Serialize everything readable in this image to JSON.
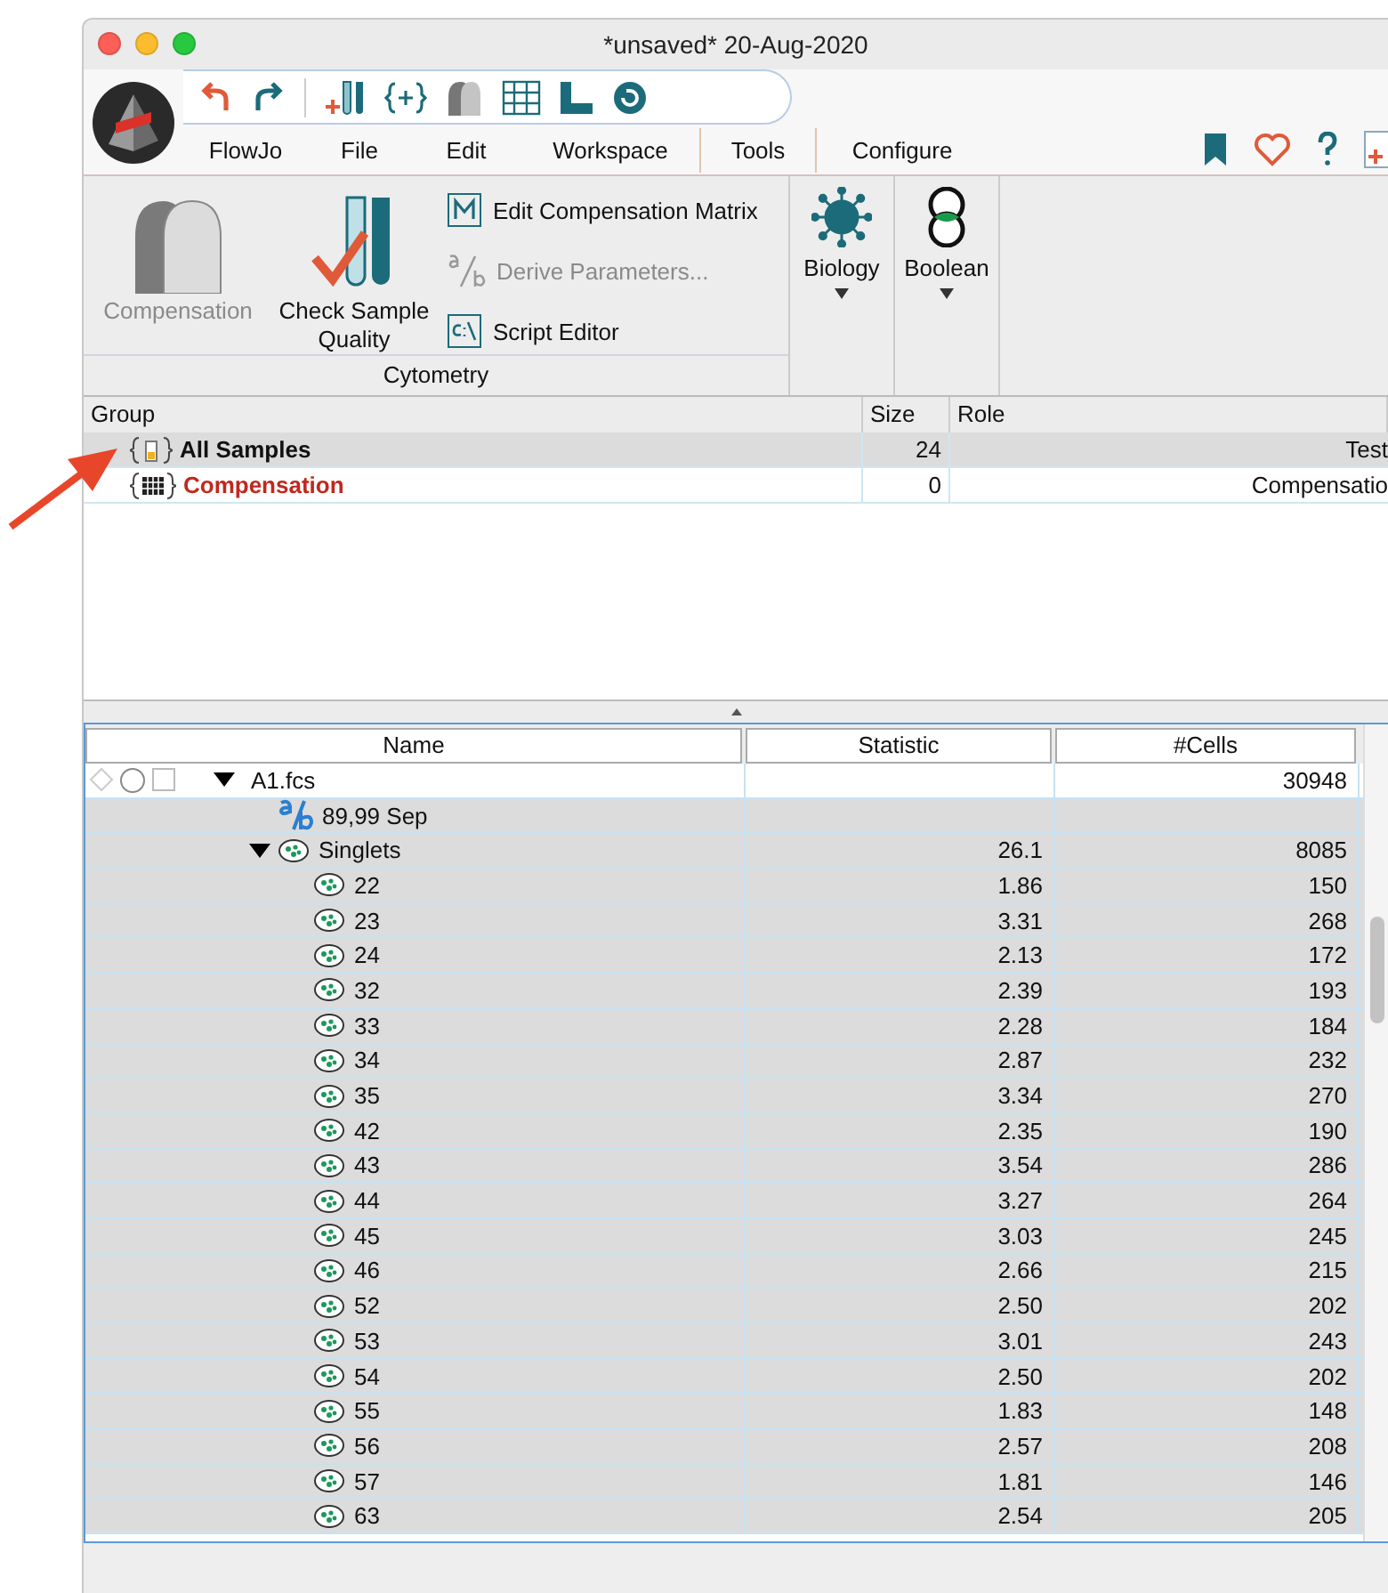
{
  "window": {
    "title": "*unsaved* 20-Aug-2020"
  },
  "menu": [
    {
      "label": "FlowJo",
      "selected": false
    },
    {
      "label": "File",
      "selected": false
    },
    {
      "label": "Edit",
      "selected": false
    },
    {
      "label": "Workspace",
      "selected": false
    },
    {
      "label": "Tools",
      "selected": true
    },
    {
      "label": "Configure",
      "selected": false
    }
  ],
  "ribbon": {
    "group_label": "Cytometry",
    "buttons": [
      {
        "kind": "large",
        "label": "Compensation",
        "disabled": true
      },
      {
        "kind": "large",
        "label": "Check Sample Quality",
        "disabled": false
      },
      {
        "kind": "small",
        "label": "Edit Compensation Matrix",
        "disabled": false
      },
      {
        "kind": "small",
        "label": "Derive Parameters...",
        "disabled": true
      },
      {
        "kind": "small",
        "label": "Script Editor",
        "disabled": false
      }
    ],
    "dropdowns": [
      {
        "label": "Biology"
      },
      {
        "label": "Boolean"
      }
    ]
  },
  "groups_table": {
    "columns": [
      "Group",
      "Size",
      "Role"
    ],
    "rows": [
      {
        "kind": "samples",
        "name": "All Samples",
        "size": "24",
        "role": "Test",
        "selected": true
      },
      {
        "kind": "compensation",
        "name": "Compensation",
        "size": "0",
        "role": "Compensatio",
        "selected": false
      }
    ]
  },
  "samples_table": {
    "columns": [
      "Name",
      "Statistic",
      "#Cells"
    ],
    "rows": [
      {
        "kind": "sample",
        "name": "A1.fcs",
        "cells": "30948",
        "expanded": true,
        "selected": false,
        "children": [
          {
            "kind": "derived",
            "name": "89,99 Sep",
            "selected": true
          },
          {
            "kind": "gate",
            "name": "Singlets",
            "statistic": "26.1",
            "cells": "8085",
            "expanded": true,
            "selected": true,
            "children": [
              {
                "kind": "gate",
                "name": "22",
                "statistic": "1.86",
                "cells": "150",
                "selected": true
              },
              {
                "kind": "gate",
                "name": "23",
                "statistic": "3.31",
                "cells": "268",
                "selected": true
              },
              {
                "kind": "gate",
                "name": "24",
                "statistic": "2.13",
                "cells": "172",
                "selected": true
              },
              {
                "kind": "gate",
                "name": "32",
                "statistic": "2.39",
                "cells": "193",
                "selected": true
              },
              {
                "kind": "gate",
                "name": "33",
                "statistic": "2.28",
                "cells": "184",
                "selected": true
              },
              {
                "kind": "gate",
                "name": "34",
                "statistic": "2.87",
                "cells": "232",
                "selected": true
              },
              {
                "kind": "gate",
                "name": "35",
                "statistic": "3.34",
                "cells": "270",
                "selected": true
              },
              {
                "kind": "gate",
                "name": "42",
                "statistic": "2.35",
                "cells": "190",
                "selected": true
              },
              {
                "kind": "gate",
                "name": "43",
                "statistic": "3.54",
                "cells": "286",
                "selected": true
              },
              {
                "kind": "gate",
                "name": "44",
                "statistic": "3.27",
                "cells": "264",
                "selected": true
              },
              {
                "kind": "gate",
                "name": "45",
                "statistic": "3.03",
                "cells": "245",
                "selected": true
              },
              {
                "kind": "gate",
                "name": "46",
                "statistic": "2.66",
                "cells": "215",
                "selected": true
              },
              {
                "kind": "gate",
                "name": "52",
                "statistic": "2.50",
                "cells": "202",
                "selected": true
              },
              {
                "kind": "gate",
                "name": "53",
                "statistic": "3.01",
                "cells": "243",
                "selected": true
              },
              {
                "kind": "gate",
                "name": "54",
                "statistic": "2.50",
                "cells": "202",
                "selected": true
              },
              {
                "kind": "gate",
                "name": "55",
                "statistic": "1.83",
                "cells": "148",
                "selected": true
              },
              {
                "kind": "gate",
                "name": "56",
                "statistic": "2.57",
                "cells": "208",
                "selected": true
              },
              {
                "kind": "gate",
                "name": "57",
                "statistic": "1.81",
                "cells": "146",
                "selected": true
              },
              {
                "kind": "gate",
                "name": "63",
                "statistic": "2.54",
                "cells": "205",
                "selected": true
              }
            ]
          }
        ]
      }
    ]
  }
}
